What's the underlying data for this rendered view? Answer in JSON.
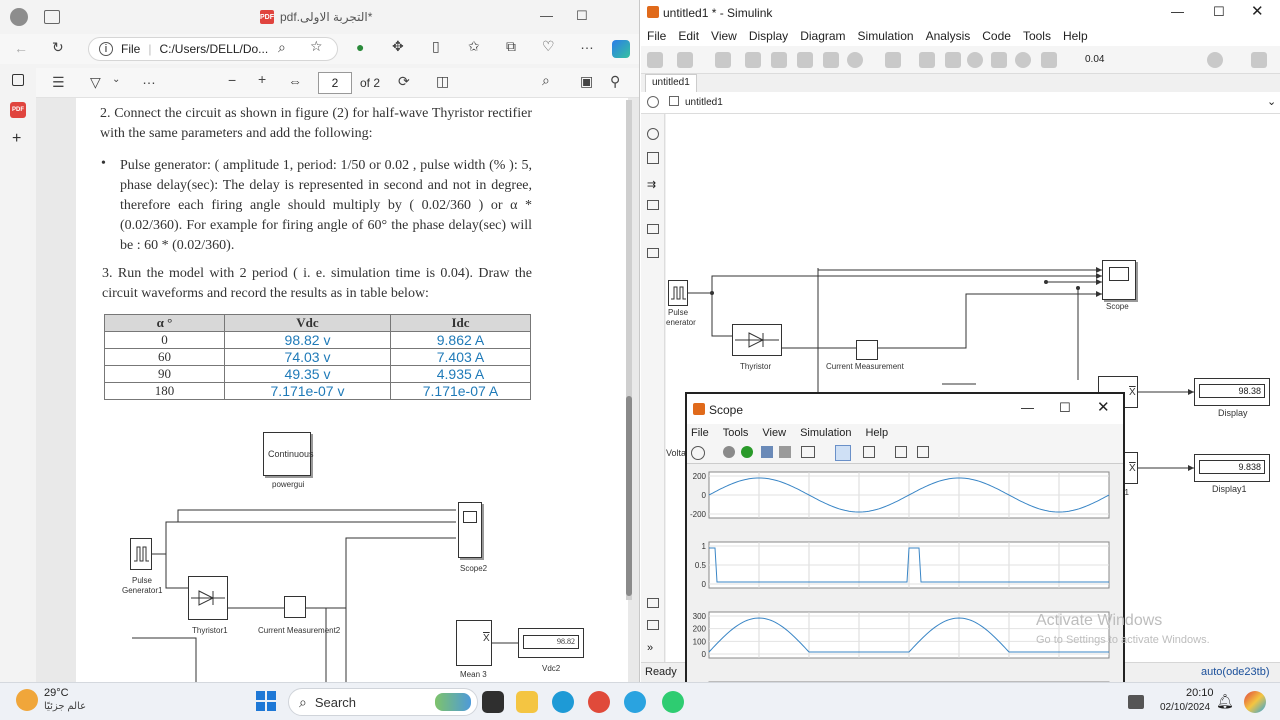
{
  "edge": {
    "tab_title": "pdf.التجربة الاولى*",
    "address_prefix": "File",
    "address": "C:/Users/DELL/Do...",
    "page_current": "2",
    "page_total": "of 2",
    "minus": "−",
    "plus": "+"
  },
  "pdf": {
    "para2": "2. Connect the circuit as shown in figure (2) for half-wave Thyristor rectifier with the same parameters and add the following:",
    "bullet": "Pulse generator: ( amplitude 1, period: 1/50 or 0.02 , pulse width (% ): 5, phase delay(sec): The delay is represented in second and not in degree, therefore each firing angle should multiply by ( 0.02/360 ) or α * (0.02/360). For example for firing angle of 60° the phase delay(sec) will be : 60 * (0.02/360).",
    "para3": "3. Run the model with 2 period ( i. e. simulation time is 0.04). Draw the circuit waveforms and record the results as in table below:",
    "table": {
      "headers": [
        "α °",
        "Vdc",
        "Idc"
      ],
      "rows": [
        [
          "0",
          "98.82 v",
          "9.862 A"
        ],
        [
          "60",
          "74.03 v",
          "7.403 A"
        ],
        [
          "90",
          "49.35 v",
          "4.935 A"
        ],
        [
          "180",
          "7.171e-07 v",
          "7.171e-07 A"
        ]
      ]
    },
    "diagram": {
      "continuous": "Continuous",
      "powergui": "powergui",
      "pulse": "Pulse Generator1",
      "thyristor": "Thyristor1",
      "current": "Current Measurement2",
      "scope": "Scope2",
      "mean": "Mean 3",
      "display_value": "98.82",
      "display": "Vdc2",
      "x_bar": "X"
    }
  },
  "simulink": {
    "title": "untitled1 * - Simulink",
    "menu": [
      "File",
      "Edit",
      "View",
      "Display",
      "Diagram",
      "Simulation",
      "Analysis",
      "Code",
      "Tools",
      "Help"
    ],
    "stop_time": "0.04",
    "tab": "untitled1",
    "breadcrumb": "untitled1",
    "blocks": {
      "pulse": "Pulse",
      "generator": "enerator",
      "thyristor": "Thyristor",
      "current": "Current Measurement",
      "scope": "Scope",
      "display": "Display",
      "display1": "Display1",
      "display_value": "98.38",
      "display1_value": "9.838",
      "x_bar": "X",
      "volta": "Volta",
      "n": "n",
      "n1": "n1"
    },
    "status_left": "Ready",
    "status_right": "auto(ode23tb)"
  },
  "scope": {
    "title": "Scope",
    "menu": [
      "File",
      "Tools",
      "View",
      "Simulation",
      "Help"
    ],
    "plot1_ticks": [
      "200",
      "0",
      "-200"
    ],
    "plot2_ticks": [
      "1",
      "0.5",
      "0"
    ],
    "plot3_ticks": [
      "300",
      "200",
      "100",
      "0"
    ],
    "plot4_ticks": [
      "30",
      "20",
      "10"
    ]
  },
  "watermark": {
    "line1": "Activate Windows",
    "line2": "Go to Settings to activate Windows."
  },
  "taskbar": {
    "weather_temp": "29°C",
    "weather_text": "عالم جزئيًا",
    "search": "Search",
    "time": "20:10",
    "date": "02/10/2024"
  }
}
